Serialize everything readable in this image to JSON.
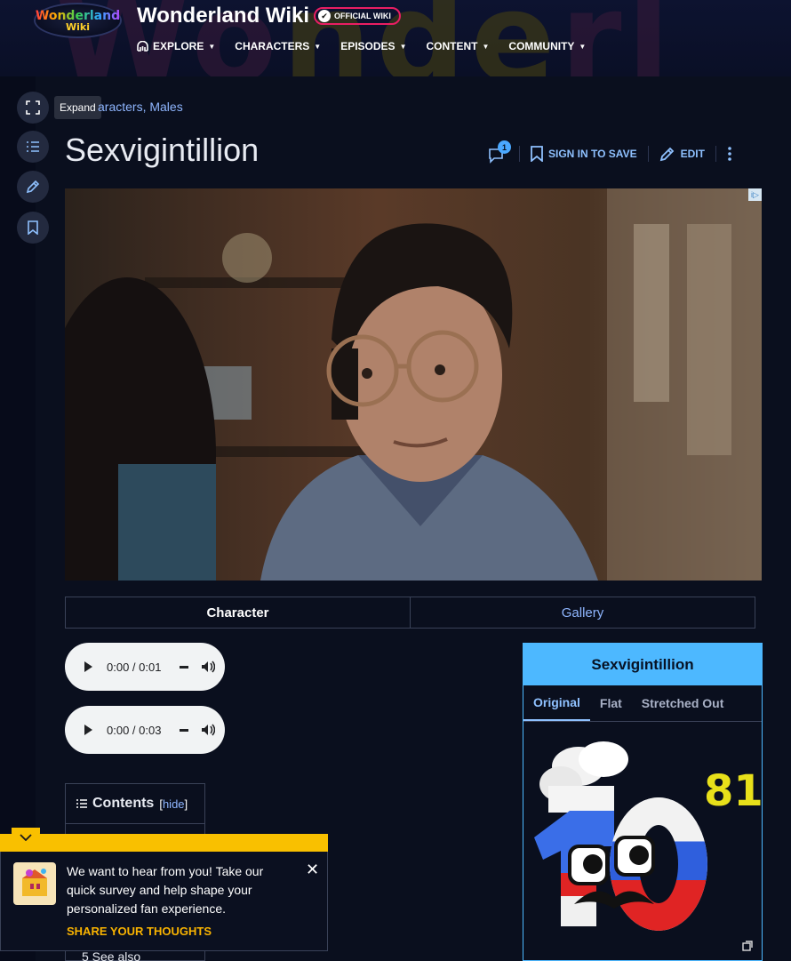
{
  "header": {
    "logo_line1": "Wonderland",
    "logo_line2": "Wiki",
    "site_title": "Wonderland Wiki",
    "official_badge": "OFFICIAL WIKI",
    "nav": [
      {
        "label": "EXPLORE",
        "icon": "explore-icon"
      },
      {
        "label": "CHARACTERS"
      },
      {
        "label": "EPISODES"
      },
      {
        "label": "CONTENT"
      },
      {
        "label": "COMMUNITY"
      }
    ]
  },
  "rail": {
    "expand_tooltip": "Expand",
    "buttons": [
      "expand-icon",
      "toc-list-icon",
      "edit-pencil-icon",
      "bookmark-icon"
    ]
  },
  "breadcrumb": {
    "text": "aracters, Males"
  },
  "page": {
    "title": "Sexvigintillion",
    "comment_count": "1",
    "sign_in_label": "SIGN IN TO SAVE",
    "edit_label": "EDIT"
  },
  "ad": {
    "marker": "i▷"
  },
  "tabs": [
    {
      "label": "Character",
      "active": true
    },
    {
      "label": "Gallery",
      "active": false
    }
  ],
  "audio": [
    {
      "time": "0:00 / 0:01"
    },
    {
      "time": "0:00 / 0:03"
    }
  ],
  "toc": {
    "title": "Contents",
    "hide_open": "[",
    "hide_label": "hide",
    "hide_close": "]",
    "visible_item": "5   See also"
  },
  "infobox": {
    "title": "Sexvigintillion",
    "tabs": [
      "Original",
      "Flat",
      "Stretched Out"
    ],
    "image_label": "81"
  },
  "survey": {
    "text": "We want to hear from you! Take our quick survey and help shape your personalized fan experience.",
    "cta": "SHARE YOUR THOUGHTS",
    "close": "✕"
  },
  "colors": {
    "accent_blue": "#4db8ff",
    "link_blue": "#8fb6ff",
    "survey_yellow": "#f9c000",
    "official_pink": "#e91e63"
  }
}
